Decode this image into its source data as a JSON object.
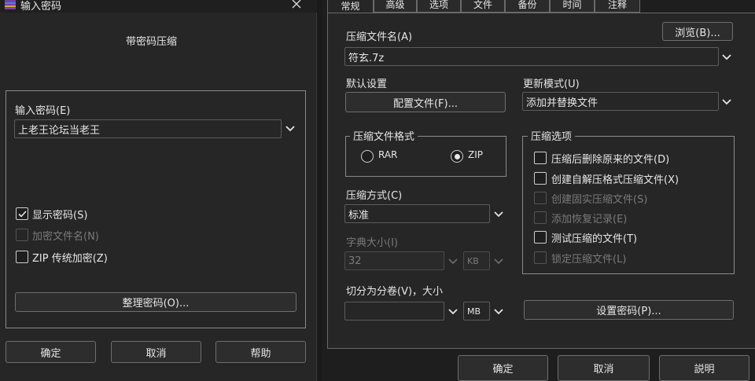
{
  "left_dialog": {
    "title": "输入密码",
    "heading": "带密码压缩",
    "password_label": "输入密码(E)",
    "password_value": "上老王论坛当老王",
    "show_password": "显示密码(S)",
    "encrypt_names": "加密文件名(N)",
    "zip_legacy": "ZIP 传统加密(Z)",
    "organize_button": "整理密码(O)...",
    "ok": "确定",
    "cancel": "取消",
    "help": "帮助"
  },
  "right_dialog": {
    "tabs": [
      "常规",
      "高级",
      "选项",
      "文件",
      "备份",
      "时间",
      "注释"
    ],
    "archive_name_label": "压缩文件名(A)",
    "browse": "浏览(B)...",
    "archive_name_value": "符玄.7z",
    "default_settings_label": "默认设置",
    "profiles_button": "配置文件(F)...",
    "update_mode_label": "更新模式(U)",
    "update_mode_value": "添加并替换文件",
    "format_group": "压缩文件格式",
    "format_rar": "RAR",
    "format_zip": "ZIP",
    "method_label": "压缩方式(C)",
    "method_value": "标准",
    "dict_label": "字典大小(I)",
    "dict_value": "32",
    "dict_unit": "KB",
    "split_label": "切分为分卷(V)，大小",
    "split_unit": "MB",
    "options_group": "压缩选项",
    "options": [
      {
        "label": "压缩后删除原来的文件(D)",
        "enabled": true
      },
      {
        "label": "创建自解压格式压缩文件(X)",
        "enabled": true
      },
      {
        "label": "创建固实压缩文件(S)",
        "enabled": false
      },
      {
        "label": "添加恢复记录(E)",
        "enabled": false
      },
      {
        "label": "测试压缩的文件(T)",
        "enabled": true
      },
      {
        "label": "锁定压缩文件(L)",
        "enabled": false
      }
    ],
    "set_password": "设置密码(P)...",
    "ok": "确定",
    "cancel": "取消",
    "help": "説明"
  }
}
